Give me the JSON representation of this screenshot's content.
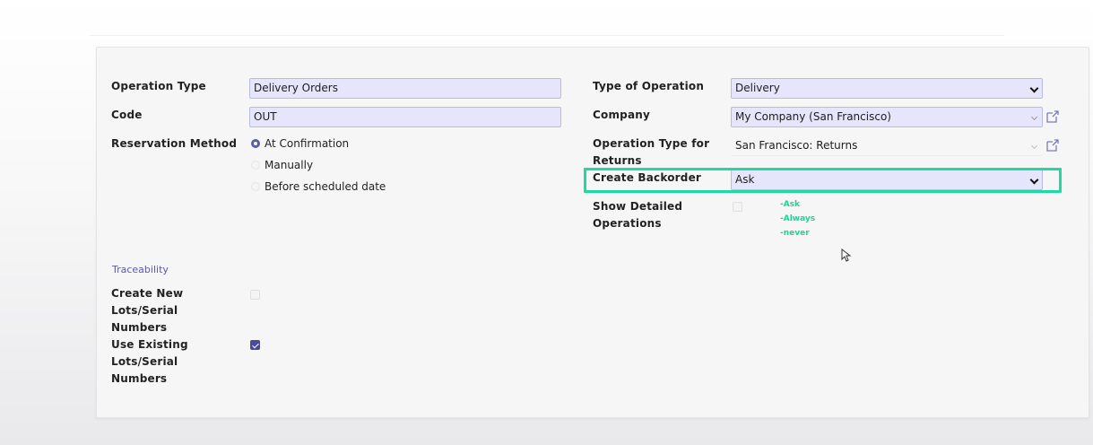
{
  "form": {
    "left": {
      "operation_type": {
        "label": "Operation Type",
        "value": "Delivery Orders"
      },
      "code": {
        "label": "Code",
        "value": "OUT"
      },
      "reservation": {
        "label": "Reservation Method",
        "options": [
          "At Confirmation",
          "Manually",
          "Before scheduled date"
        ],
        "selected": "At Confirmation"
      }
    },
    "right": {
      "type_of_operation": {
        "label": "Type of Operation",
        "value": "Delivery"
      },
      "company": {
        "label": "Company",
        "value": "My Company (San Francisco)"
      },
      "returns_type": {
        "label_line1": "Operation Type for",
        "label_line2": "Returns",
        "value": "San Francisco: Returns"
      },
      "backorder": {
        "label": "Create Backorder",
        "value": "Ask"
      },
      "detailed": {
        "label_line1": "Show Detailed",
        "label_line2": "Operations",
        "checked": false
      }
    },
    "annotation": {
      "lines": [
        "-Ask",
        "-Always",
        "-never"
      ],
      "color": "#12d89a"
    },
    "traceability": {
      "section_title": "Traceability",
      "create_new": {
        "lines": [
          "Create New",
          "Lots/Serial",
          "Numbers"
        ],
        "checked": false
      },
      "use_existing": {
        "lines": [
          "Use Existing",
          "Lots/Serial",
          "Numbers"
        ],
        "checked": true
      }
    }
  },
  "colors": {
    "accent": "#5c5ca8",
    "field_bg": "#e5e5fb",
    "highlight": "#1ed9a0"
  }
}
